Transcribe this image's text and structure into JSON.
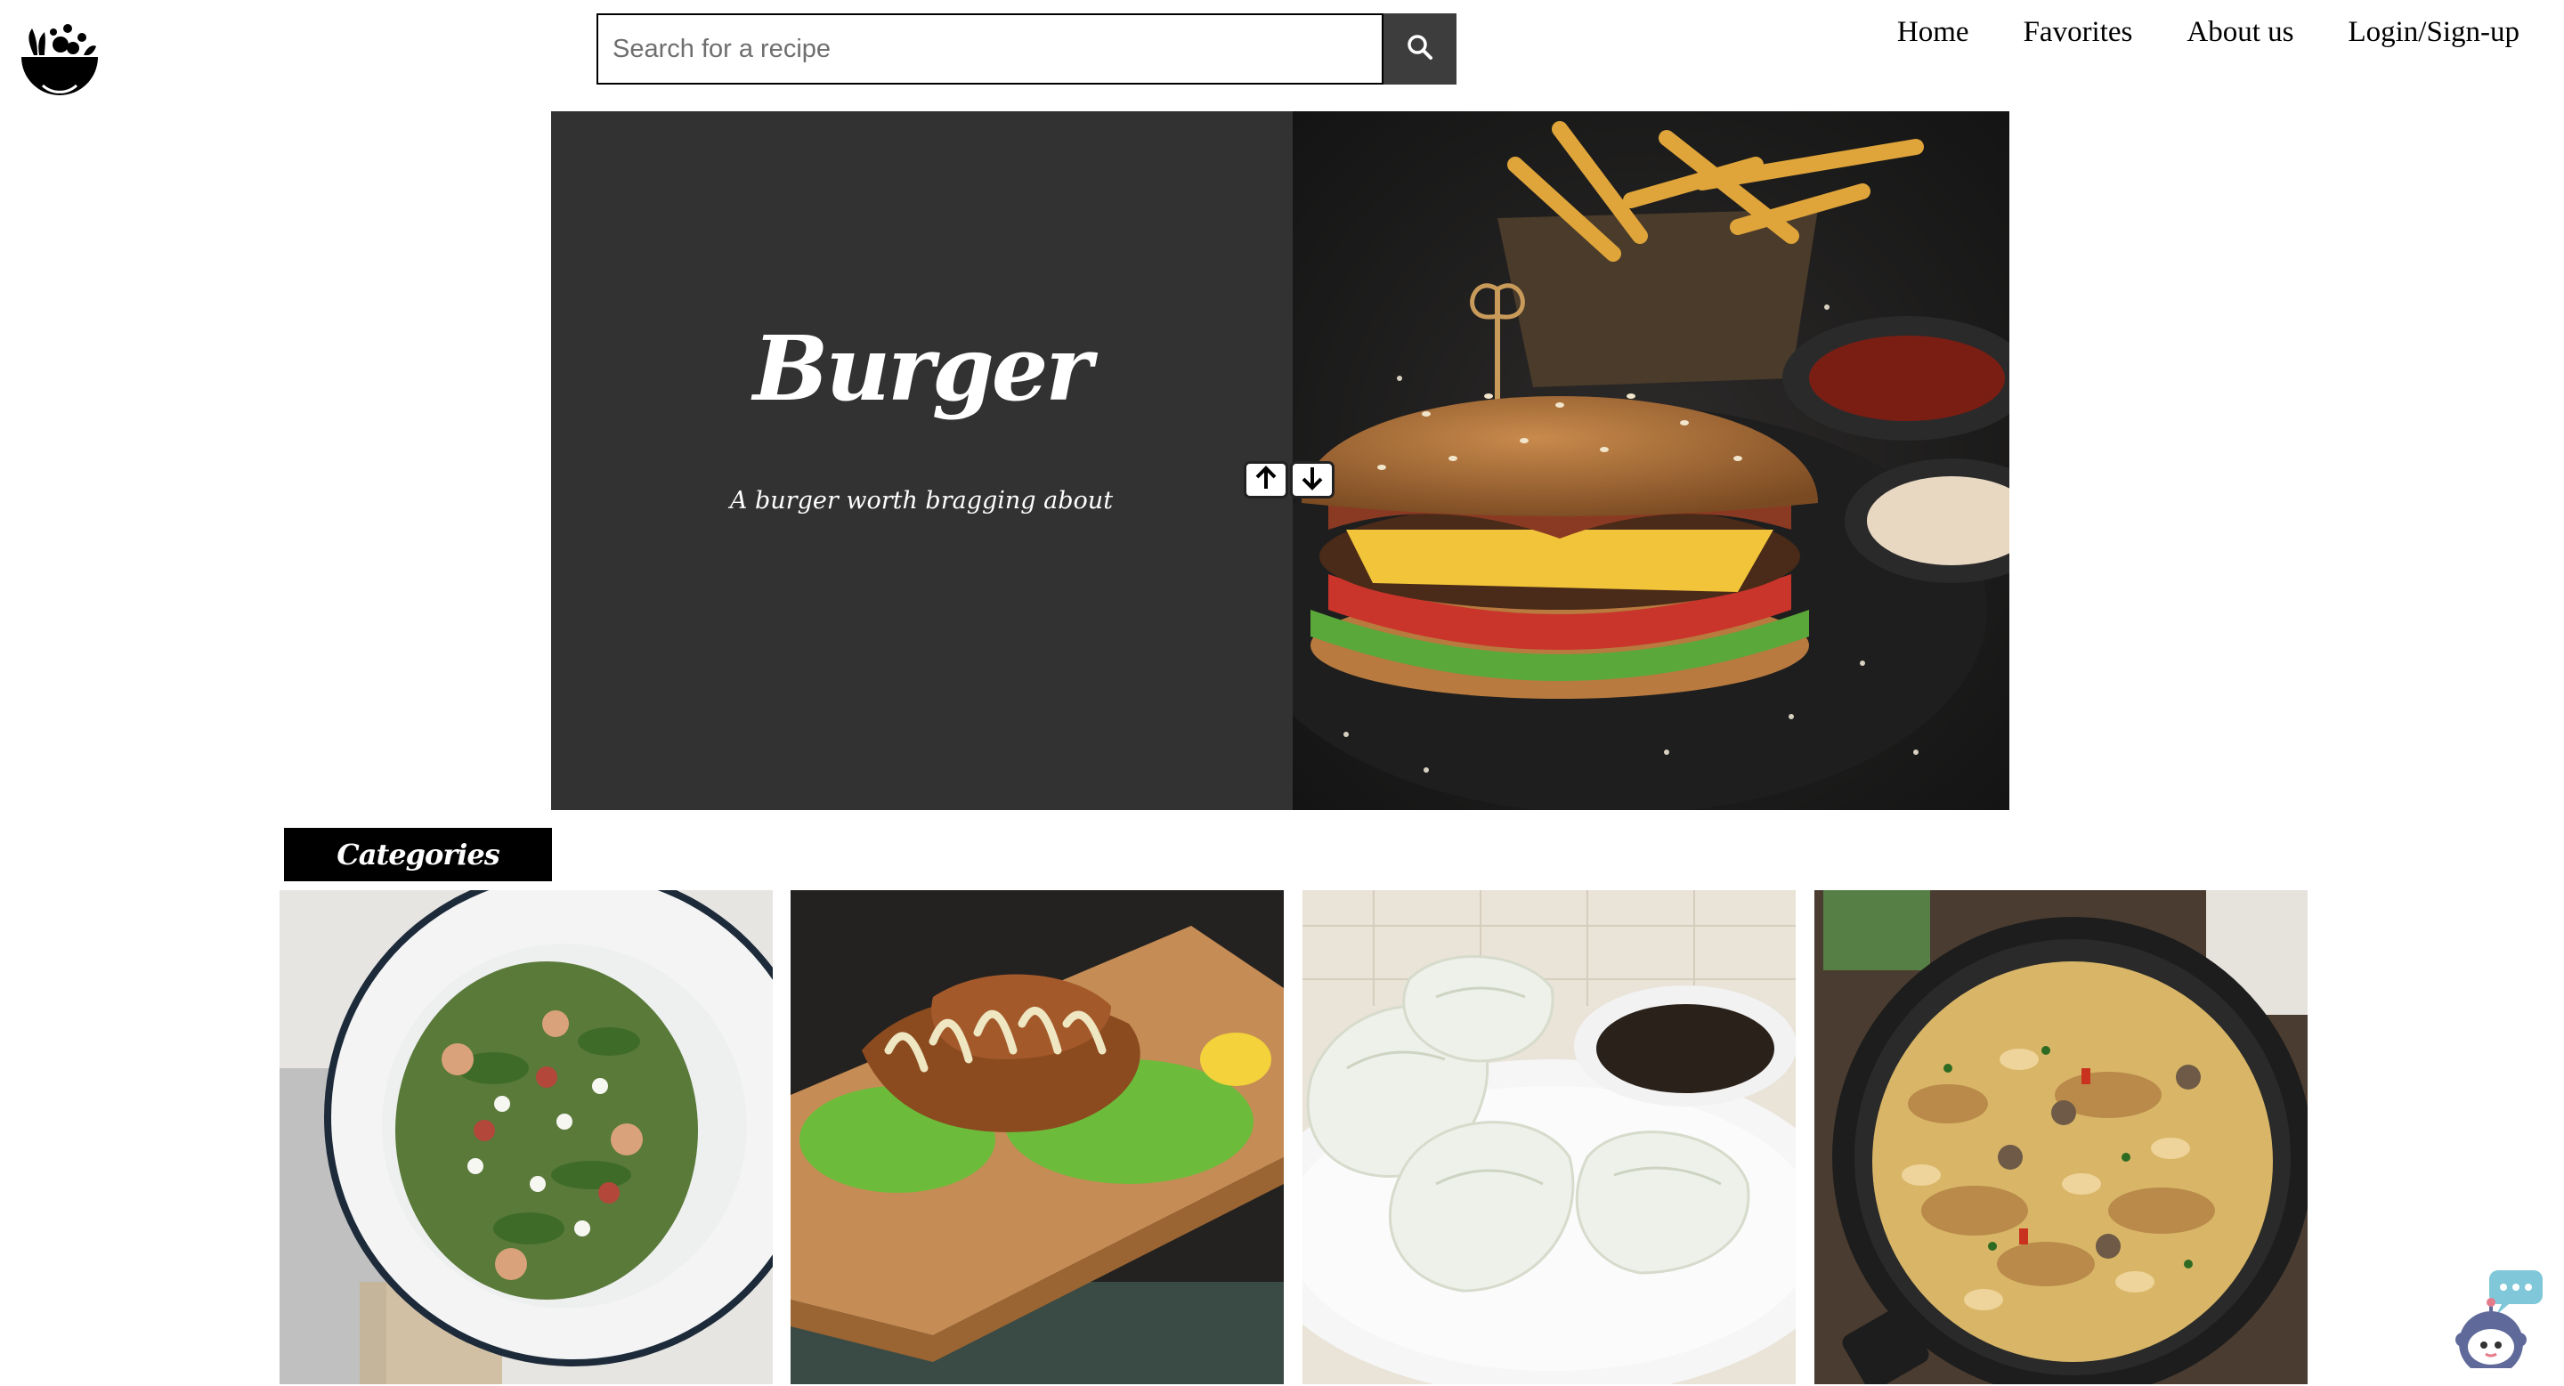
{
  "header": {
    "logo_icon": "salad-bowl-logo",
    "search": {
      "placeholder": "Search for a recipe",
      "button_icon": "search-icon"
    },
    "nav": [
      {
        "label": "Home"
      },
      {
        "label": "Favorites"
      },
      {
        "label": "About us"
      },
      {
        "label": "Login/Sign-up"
      }
    ]
  },
  "hero": {
    "title": "Burger",
    "subtitle": "A burger worth bragging about",
    "image_icon": "burger-photo",
    "controls": {
      "up_icon": "arrow-up-icon",
      "down_icon": "arrow-down-icon"
    }
  },
  "categories": {
    "title": "Categories",
    "items": [
      {
        "image_icon": "salad-photo"
      },
      {
        "image_icon": "fried-chicken-photo"
      },
      {
        "image_icon": "dumplings-photo"
      },
      {
        "image_icon": "pasta-photo"
      }
    ]
  },
  "chatbot": {
    "icon": "chatbot-robot-icon"
  },
  "colors": {
    "hero_bg": "#323232",
    "search_button": "#3d3d3d",
    "categories_bg": "#000000"
  }
}
